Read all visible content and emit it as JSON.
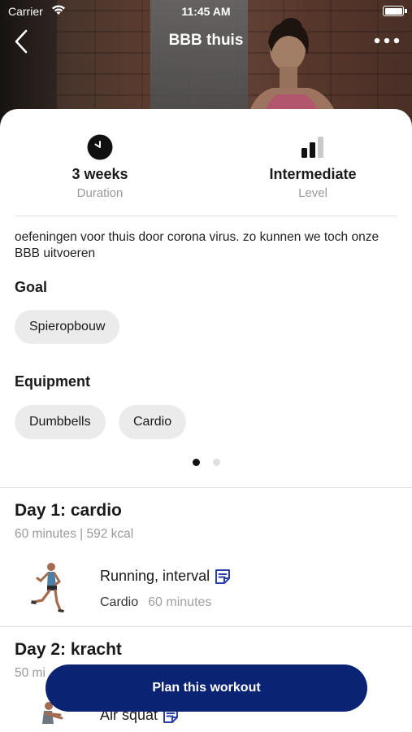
{
  "status_bar": {
    "carrier": "Carrier",
    "time": "11:45 AM"
  },
  "nav": {
    "title": "BBB thuis",
    "back_icon": "chevron-left-icon",
    "more_icon": "more-horizontal-icon"
  },
  "stats": {
    "duration": {
      "value": "3 weeks",
      "label": "Duration",
      "icon": "clock-icon"
    },
    "level": {
      "value": "Intermediate",
      "label": "Level",
      "icon": "signal-bars-icon"
    }
  },
  "description": "oefeningen voor thuis door corona virus. zo kunnen we toch onze BBB uitvoeren",
  "goal": {
    "heading": "Goal",
    "chips": [
      "Spieropbouw"
    ]
  },
  "equipment": {
    "heading": "Equipment",
    "chips": [
      "Dumbbells",
      "Cardio"
    ]
  },
  "pagination": {
    "count": 2,
    "active": 1
  },
  "days": [
    {
      "title": "Day 1: cardio",
      "meta": "60 minutes | 592 kcal",
      "exercise": {
        "name": "Running, interval",
        "category": "Cardio",
        "duration": "60 minutes",
        "note_icon": "note-icon"
      }
    },
    {
      "title": "Day 2: kracht",
      "meta": "50 mi",
      "exercise": {
        "name": "Air squat",
        "note_icon": "note-icon"
      }
    }
  ],
  "cta": {
    "label": "Plan this workout"
  },
  "colors": {
    "accent": "#0a2373",
    "chip_bg": "#ebebeb",
    "note_icon": "#2a3ea8",
    "muted_text": "#9a9a9a"
  }
}
